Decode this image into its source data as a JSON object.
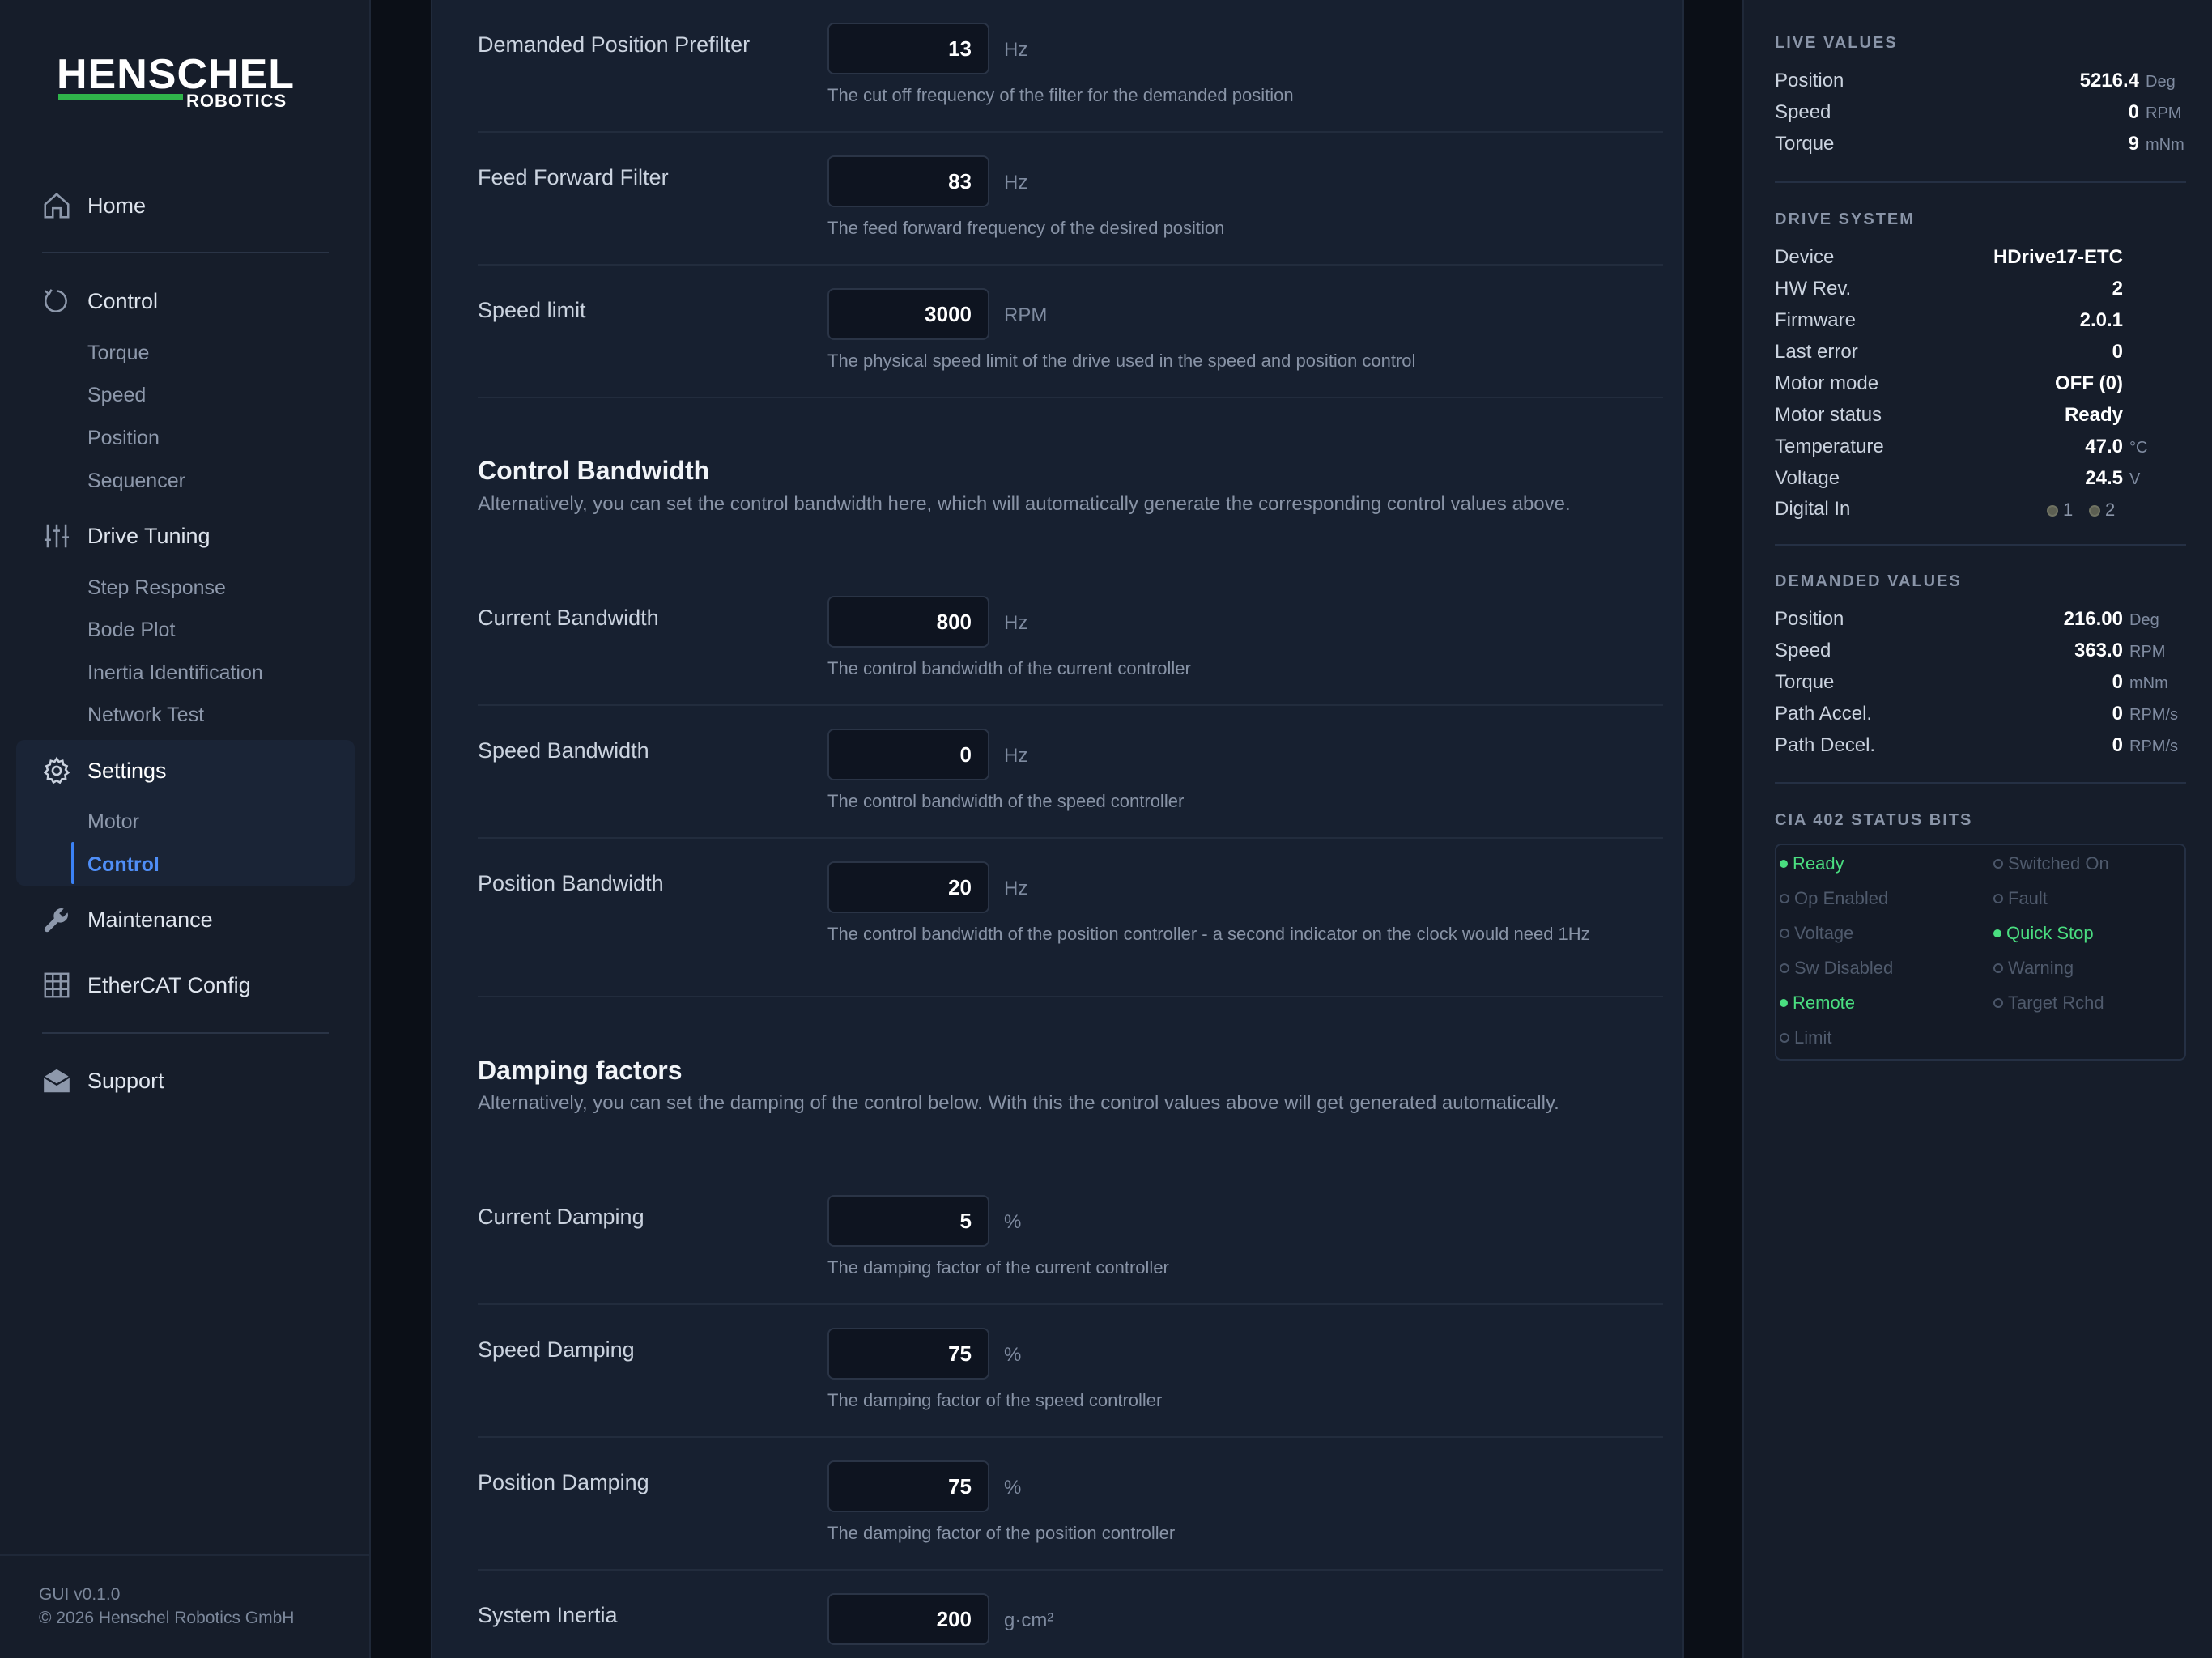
{
  "brand": {
    "name": "HENSCHEL",
    "sub": "ROBOTICS",
    "accent": "#2fb44a"
  },
  "nav": {
    "home": "Home",
    "control": "Control",
    "control_sub": [
      "Torque",
      "Speed",
      "Position",
      "Sequencer"
    ],
    "drive_tuning": "Drive Tuning",
    "drive_tuning_sub": [
      "Step Response",
      "Bode Plot",
      "Inertia Identification",
      "Network Test"
    ],
    "settings": "Settings",
    "settings_sub": [
      "Motor",
      "Control"
    ],
    "maintenance": "Maintenance",
    "ethercat": "EtherCAT Config",
    "support": "Support",
    "active_sub": "Control",
    "icons": [
      "home-icon",
      "control-loop-icon",
      "sliders-icon",
      "gear-icon",
      "wrench-icon",
      "grid-icon",
      "mail-icon"
    ]
  },
  "footer": {
    "version": "GUI v0.1.0",
    "copyright": "© 2026 Henschel Robotics GmbH"
  },
  "main": {
    "rows": [
      {
        "label": "Demanded Position Prefilter",
        "value": "13",
        "unit": "Hz",
        "desc": "The cut off frequency of the filter for the demanded position"
      },
      {
        "label": "Feed Forward Filter",
        "value": "83",
        "unit": "Hz",
        "desc": "The feed forward frequency of the desired position"
      },
      {
        "label": "Speed limit",
        "value": "3000",
        "unit": "RPM",
        "desc": "The physical speed limit of the drive used in the speed and position control"
      }
    ],
    "bandwidth": {
      "title": "Control Bandwidth",
      "desc": "Alternatively, you can set the control bandwidth here, which will automatically generate the corresponding control values above.",
      "rows": [
        {
          "label": "Current Bandwidth",
          "value": "800",
          "unit": "Hz",
          "desc": "The control bandwidth of the current controller"
        },
        {
          "label": "Speed Bandwidth",
          "value": "0",
          "unit": "Hz",
          "desc": "The control bandwidth of the speed controller"
        },
        {
          "label": "Position Bandwidth",
          "value": "20",
          "unit": "Hz",
          "desc": "The control bandwidth of the position controller - a second indicator on the clock would need 1Hz"
        }
      ]
    },
    "damping": {
      "title": "Damping factors",
      "desc": "Alternatively, you can set the damping of the control below. With this the control values above will get generated automatically.",
      "rows": [
        {
          "label": "Current Damping",
          "value": "5",
          "unit": "%",
          "desc": "The damping factor of the current controller"
        },
        {
          "label": "Speed Damping",
          "value": "75",
          "unit": "%",
          "desc": "The damping factor of the speed controller"
        },
        {
          "label": "Position Damping",
          "value": "75",
          "unit": "%",
          "desc": "The damping factor of the position controller"
        },
        {
          "label": "System Inertia",
          "value": "200",
          "unit": "g·cm²",
          "desc": ""
        }
      ]
    }
  },
  "live": {
    "heading": "LIVE VALUES",
    "rows": [
      {
        "label": "Position",
        "value": "5216.4",
        "unit": "Deg"
      },
      {
        "label": "Speed",
        "value": "0",
        "unit": "RPM"
      },
      {
        "label": "Torque",
        "value": "9",
        "unit": "mNm"
      }
    ]
  },
  "drive": {
    "heading": "DRIVE SYSTEM",
    "rows": [
      {
        "label": "Device",
        "value": "HDrive17-ETC",
        "unit": ""
      },
      {
        "label": "HW Rev.",
        "value": "2",
        "unit": ""
      },
      {
        "label": "Firmware",
        "value": "2.0.1",
        "unit": ""
      },
      {
        "label": "Last error",
        "value": "0",
        "unit": ""
      },
      {
        "label": "Motor mode",
        "value": "OFF (0)",
        "unit": ""
      },
      {
        "label": "Motor status",
        "value": "Ready",
        "unit": ""
      },
      {
        "label": "Temperature",
        "value": "47.0",
        "unit": "°C"
      },
      {
        "label": "Voltage",
        "value": "24.5",
        "unit": "V"
      }
    ],
    "digital_in_label": "Digital In",
    "digital_in": [
      "1",
      "2"
    ]
  },
  "demanded": {
    "heading": "DEMANDED VALUES",
    "rows": [
      {
        "label": "Position",
        "value": "216.00",
        "unit": "Deg"
      },
      {
        "label": "Speed",
        "value": "363.0",
        "unit": "RPM"
      },
      {
        "label": "Torque",
        "value": "0",
        "unit": "mNm"
      },
      {
        "label": "Path Accel.",
        "value": "0",
        "unit": "RPM/s"
      },
      {
        "label": "Path Decel.",
        "value": "0",
        "unit": "RPM/s"
      }
    ]
  },
  "status": {
    "heading": "CIA 402 STATUS BITS",
    "bits": [
      {
        "label": "Ready",
        "on": true
      },
      {
        "label": "Switched On",
        "on": false
      },
      {
        "label": "Op Enabled",
        "on": false
      },
      {
        "label": "Fault",
        "on": false
      },
      {
        "label": "Voltage",
        "on": false
      },
      {
        "label": "Quick Stop",
        "on": true
      },
      {
        "label": "Sw Disabled",
        "on": false
      },
      {
        "label": "Warning",
        "on": false
      },
      {
        "label": "Remote",
        "on": true
      },
      {
        "label": "Target Rchd",
        "on": false
      },
      {
        "label": "Limit",
        "on": false
      }
    ],
    "on_color": "#4ade80"
  }
}
